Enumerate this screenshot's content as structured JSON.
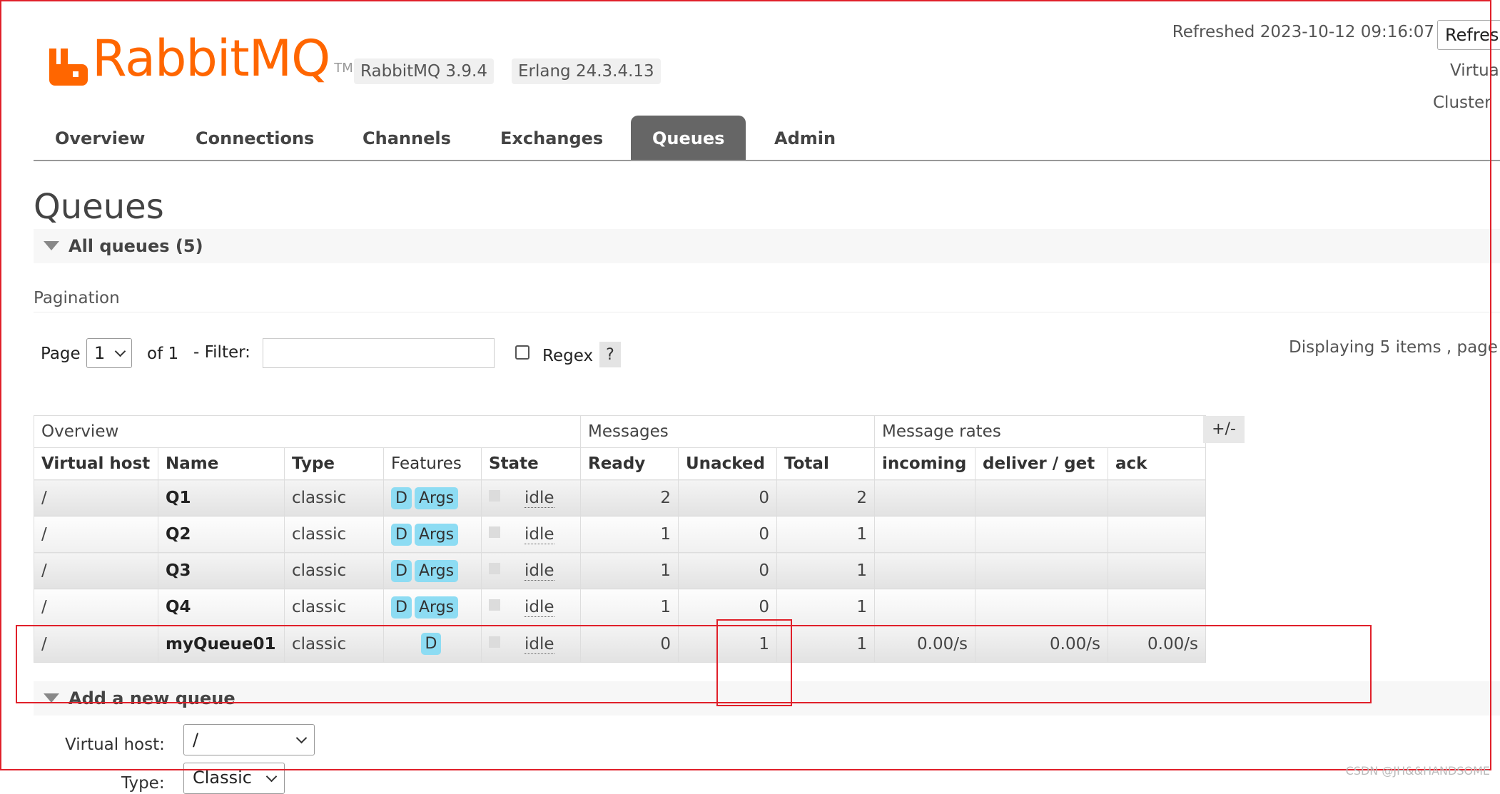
{
  "header": {
    "logo_text": "RabbitMQ",
    "logo_tm": "TM",
    "rabbitmq_version": "RabbitMQ 3.9.4",
    "erlang_version": "Erlang 24.3.4.13",
    "refreshed": "Refreshed 2023-10-12 09:16:07",
    "refresh_button": "Refres",
    "virtual_host_label": "Virtua",
    "cluster_label": "Cluster"
  },
  "nav": {
    "tabs": [
      {
        "label": "Overview",
        "selected": false
      },
      {
        "label": "Connections",
        "selected": false
      },
      {
        "label": "Channels",
        "selected": false
      },
      {
        "label": "Exchanges",
        "selected": false
      },
      {
        "label": "Queues",
        "selected": true
      },
      {
        "label": "Admin",
        "selected": false
      }
    ]
  },
  "page": {
    "title": "Queues",
    "all_queues_label": "All queues (5)"
  },
  "pagination": {
    "label": "Pagination",
    "page_label": "Page",
    "page_value": "1",
    "of_label": "of 1",
    "filter_label": "- Filter:",
    "filter_value": "",
    "regex_label": "Regex",
    "regex_checked": false,
    "help_label": "?",
    "displaying": "Displaying 5 items , page"
  },
  "table": {
    "groups": [
      "Overview",
      "Messages",
      "Message rates"
    ],
    "columns": [
      "Virtual host",
      "Name",
      "Type",
      "Features",
      "State",
      "Ready",
      "Unacked",
      "Total",
      "incoming",
      "deliver / get",
      "ack"
    ],
    "toggle_label": "+/-",
    "rows": [
      {
        "vhost": "/",
        "name": "Q1",
        "type": "classic",
        "features": [
          "D",
          "Args"
        ],
        "state": "idle",
        "ready": "2",
        "unacked": "0",
        "total": "2",
        "incoming": "",
        "deliver_get": "",
        "ack": ""
      },
      {
        "vhost": "/",
        "name": "Q2",
        "type": "classic",
        "features": [
          "D",
          "Args"
        ],
        "state": "idle",
        "ready": "1",
        "unacked": "0",
        "total": "1",
        "incoming": "",
        "deliver_get": "",
        "ack": ""
      },
      {
        "vhost": "/",
        "name": "Q3",
        "type": "classic",
        "features": [
          "D",
          "Args"
        ],
        "state": "idle",
        "ready": "1",
        "unacked": "0",
        "total": "1",
        "incoming": "",
        "deliver_get": "",
        "ack": ""
      },
      {
        "vhost": "/",
        "name": "Q4",
        "type": "classic",
        "features": [
          "D",
          "Args"
        ],
        "state": "idle",
        "ready": "1",
        "unacked": "0",
        "total": "1",
        "incoming": "",
        "deliver_get": "",
        "ack": ""
      },
      {
        "vhost": "/",
        "name": "myQueue01",
        "type": "classic",
        "features": [
          "D"
        ],
        "state": "idle",
        "ready": "0",
        "unacked": "1",
        "total": "1",
        "incoming": "0.00/s",
        "deliver_get": "0.00/s",
        "ack": "0.00/s"
      }
    ]
  },
  "add_queue": {
    "label": "Add a new queue",
    "virtual_host_label": "Virtual host:",
    "virtual_host_value": "/",
    "type_label": "Type:",
    "type_value": "Classic"
  },
  "watermark": "CSDN @JH&&HANDSOME",
  "colors": {
    "brand_orange": "#ff6600",
    "selected_tab": "#666666",
    "feature_badge": "#8ddcf3",
    "annotation_red": "#e0202a"
  }
}
